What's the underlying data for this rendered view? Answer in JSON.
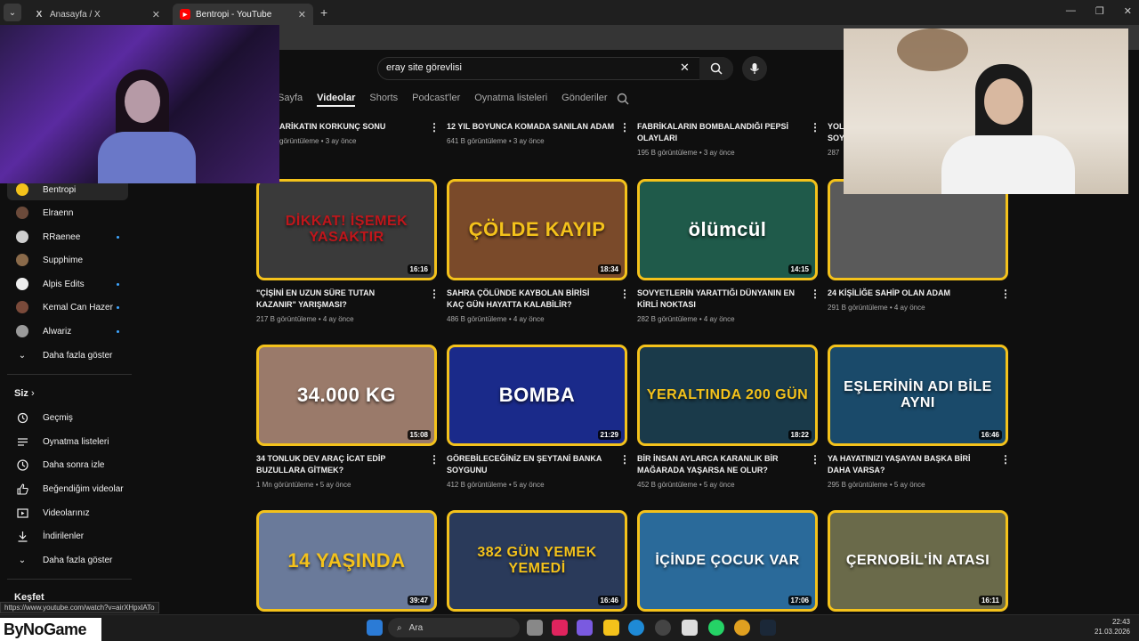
{
  "browser": {
    "tabs": [
      {
        "title": "Anasayfa / X",
        "favicon": "x-logo-icon",
        "active": false
      },
      {
        "title": "Bentropi - YouTube",
        "favicon": "youtube-icon",
        "active": true
      }
    ],
    "new_tab": "+"
  },
  "search": {
    "query": "eray site görevlisi"
  },
  "channel_tabs": [
    {
      "label": "Sayfa",
      "active": false
    },
    {
      "label": "Videolar",
      "active": true
    },
    {
      "label": "Shorts",
      "active": false
    },
    {
      "label": "Podcast'ler",
      "active": false
    },
    {
      "label": "Oynatma listeleri",
      "active": false
    },
    {
      "label": "Gönderiler",
      "active": false
    }
  ],
  "sidebar": {
    "subscriptions": [
      {
        "label": "Bentropi",
        "selected": true,
        "new": false,
        "avatar_color": "#f4c21b"
      },
      {
        "label": "Elraenn",
        "selected": false,
        "new": false,
        "avatar_color": "#6b4a3a"
      },
      {
        "label": "RRaenee",
        "selected": false,
        "new": true,
        "avatar_color": "#cfcfcf"
      },
      {
        "label": "Supphime",
        "selected": false,
        "new": false,
        "avatar_color": "#8a6a4a"
      },
      {
        "label": "Alpis Edits",
        "selected": false,
        "new": true,
        "avatar_color": "#eeeeee"
      },
      {
        "label": "Kemal Can Hazer",
        "selected": false,
        "new": true,
        "avatar_color": "#7a4a3a"
      },
      {
        "label": "Alwariz",
        "selected": false,
        "new": true,
        "avatar_color": "#9a9a9a"
      }
    ],
    "show_more_subs": "Daha fazla göster",
    "you_heading": "Siz",
    "you_items": [
      {
        "label": "Geçmiş",
        "icon": "history-icon"
      },
      {
        "label": "Oynatma listeleri",
        "icon": "playlist-icon"
      },
      {
        "label": "Daha sonra izle",
        "icon": "watch-later-icon"
      },
      {
        "label": "Beğendiğim videolar",
        "icon": "thumbs-up-icon"
      },
      {
        "label": "Videolarınız",
        "icon": "your-videos-icon"
      },
      {
        "label": "İndirilenler",
        "icon": "download-icon"
      }
    ],
    "show_more_you": "Daha fazla göster",
    "explore_heading": "Keşfet"
  },
  "partial_row": [
    {
      "title": "ARİKATIN KORKUNÇ SONU",
      "meta": "görüntüleme • 3 ay önce"
    },
    {
      "title": "12 YIL BOYUNCA KOMADA SANILAN ADAM",
      "meta": "641 B görüntüleme • 3 ay önce"
    },
    {
      "title": "FABRİKALARIN BOMBALANDIĞI PEPSİ OLAYLARI",
      "meta": "195 B görüntüleme • 3 ay önce"
    },
    {
      "title": "YOL SOY",
      "meta": "287"
    }
  ],
  "videos": [
    {
      "title": "\"ÇİŞİNİ EN UZUN SÜRE TUTAN KAZANIR\" YARIŞMASI?",
      "meta": "217 B görüntüleme • 4 ay önce",
      "duration": "16:16",
      "thumb_text": "DİKKAT! İŞEMEK YASAKTIR",
      "thumb_bg": "#3a3a3a",
      "thumb_fg": "#c0161b"
    },
    {
      "title": "SAHRA ÇÖLÜNDE KAYBOLAN BİRİSİ KAÇ GÜN HAYATTA KALABİLİR?",
      "meta": "486 B görüntüleme • 4 ay önce",
      "duration": "18:34",
      "thumb_text": "ÇÖLDE KAYIP",
      "thumb_bg": "#7a4a2a",
      "thumb_fg": "#f4c21b"
    },
    {
      "title": "SOVYETLERİN YARATTIĞI DÜNYANIN EN KİRLİ NOKTASI",
      "meta": "282 B görüntüleme • 4 ay önce",
      "duration": "14:15",
      "thumb_text": "ölümcül",
      "thumb_bg": "#1f5a4a",
      "thumb_fg": "#ffffff"
    },
    {
      "title": "24 KİŞİLİĞE SAHİP OLAN ADAM",
      "meta": "291 B görüntüleme • 4 ay önce",
      "duration": "",
      "thumb_text": "",
      "thumb_bg": "#5a5a5a",
      "thumb_fg": "#ffffff"
    },
    {
      "title": "34 TONLUK DEV ARAÇ İCAT EDİP BUZULLARA GİTMEK?",
      "meta": "1 Mn görüntüleme • 5 ay önce",
      "duration": "15:08",
      "thumb_text": "34.000 KG",
      "thumb_bg": "#9a7a6a",
      "thumb_fg": "#ffffff"
    },
    {
      "title": "GÖREBİLECEĞİNİZ EN ŞEYTANİ BANKA SOYGUNU",
      "meta": "412 B görüntüleme • 5 ay önce",
      "duration": "21:29",
      "thumb_text": "BOMBA",
      "thumb_bg": "#1a2a8a",
      "thumb_fg": "#ffffff"
    },
    {
      "title": "BİR İNSAN AYLARCA KARANLIK BİR MAĞARADA YAŞARSA NE OLUR?",
      "meta": "452 B görüntüleme • 5 ay önce",
      "duration": "18:22",
      "thumb_text": "YERALTINDA 200 GÜN",
      "thumb_bg": "#1a3a4a",
      "thumb_fg": "#f4c21b"
    },
    {
      "title": "YA HAYATINIZI YAŞAYAN BAŞKA BİRİ DAHA VARSA?",
      "meta": "295 B görüntüleme • 5 ay önce",
      "duration": "16:46",
      "thumb_text": "EŞLERİNİN ADI BİLE AYNI",
      "thumb_bg": "#1a4a6a",
      "thumb_fg": "#ffffff"
    },
    {
      "title": "",
      "meta": "",
      "duration": "39:47",
      "thumb_text": "14 YAŞINDA",
      "thumb_bg": "#6a7a9a",
      "thumb_fg": "#f4c21b"
    },
    {
      "title": "",
      "meta": "",
      "duration": "16:46",
      "thumb_text": "382 GÜN YEMEK YEMEDİ",
      "thumb_bg": "#2a3a5a",
      "thumb_fg": "#f4c21b"
    },
    {
      "title": "",
      "meta": "",
      "duration": "17:06",
      "thumb_text": "İÇİNDE ÇOCUK VAR",
      "thumb_bg": "#2a6a9a",
      "thumb_fg": "#ffffff"
    },
    {
      "title": "",
      "meta": "",
      "duration": "16:11",
      "thumb_text": "ÇERNOBİL'İN ATASI",
      "thumb_bg": "#6a6a4a",
      "thumb_fg": "#ffffff"
    }
  ],
  "status_url": "https://www.youtube.com/watch?v=airXHpxlATo",
  "taskbar": {
    "logo": "ByNoGame",
    "search_label": "Ara",
    "time": "22:43",
    "date": "21.03.2026"
  }
}
